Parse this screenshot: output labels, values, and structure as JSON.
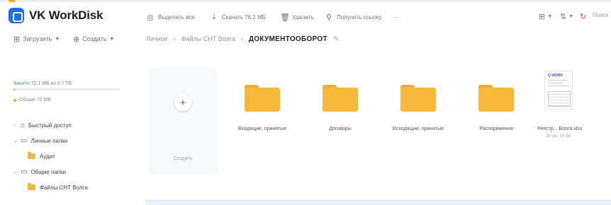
{
  "app": {
    "title": "VK WorkDisk",
    "accent": "#1f6ee8",
    "folder_color": "#f7b93b"
  },
  "toolbar": {
    "items": [
      {
        "icon": "check-circle-icon",
        "label": "Выделить все"
      },
      {
        "icon": "download-icon",
        "label": "Скачать 76.2 МБ"
      },
      {
        "icon": "trash-icon",
        "label": "Удалить"
      },
      {
        "icon": "link-icon",
        "label": "Получить ссылку"
      },
      {
        "icon": "more-icon",
        "label": "···"
      }
    ],
    "right": {
      "view_icon": "grid-view-icon",
      "sort_icon": "sort-icon",
      "sync_icon": "sync-icon",
      "search_hint": "Поиск"
    }
  },
  "actions": {
    "upload": "Загрузить",
    "create": "Создать"
  },
  "breadcrumb": {
    "items": [
      "Личное",
      "Файлы СНТ Волга"
    ],
    "current": "ДОКУМЕНТООБОРОТ"
  },
  "sidebar": {
    "quota": {
      "text": "Занято 72.1 МБ из 0.7 ТБ",
      "legend": "Общие 72 МБ",
      "fill_fraction": 0.01
    },
    "nav": [
      {
        "label": "Быстрый доступ"
      },
      {
        "label": "Личные папки"
      },
      {
        "label": "Аудит"
      },
      {
        "label": "Общие папки"
      },
      {
        "label": "Файлы СНТ Волга"
      }
    ]
  },
  "main": {
    "create_label": "Создать",
    "folders": [
      {
        "name": "Входящие, принятые"
      },
      {
        "name": "Договоры"
      },
      {
        "name": "Исходящие, принятые"
      },
      {
        "name": "Распоряжения"
      }
    ],
    "document": {
      "name": "Реестр... Волга.xlsx",
      "date": "30 окт. 15:58",
      "thumb_title": "Q WORK"
    }
  }
}
